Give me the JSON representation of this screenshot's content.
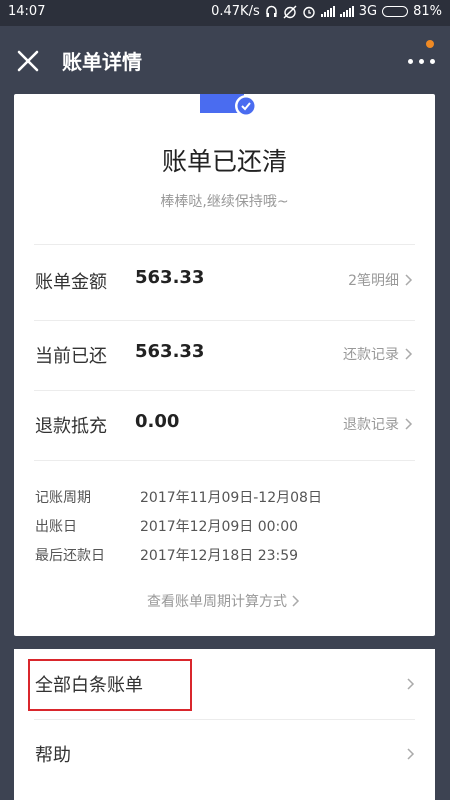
{
  "status_bar": {
    "time": "14:07",
    "network_speed": "0.47K/s",
    "network_type": "3G",
    "battery": "81%",
    "battery_level": 0.81,
    "icons": [
      "headphones-icon",
      "alarm-off-icon",
      "alarm-icon",
      "signal-icon",
      "signal-icon",
      "battery-icon"
    ]
  },
  "header": {
    "title": "账单详情",
    "close_icon": "close-icon",
    "more_icon": "more-icon",
    "notify_color": "#f08a24"
  },
  "bill_status": {
    "title": "账单已还清",
    "subtitle": "棒棒哒,继续保持哦~",
    "icon": "bill-check-icon",
    "icon_color": "#4a6cf0"
  },
  "rows": [
    {
      "label": "账单金额",
      "amount": "563.33",
      "link": "2笔明细"
    },
    {
      "label": "当前已还",
      "amount": "563.33",
      "link": "还款记录"
    },
    {
      "label": "退款抵充",
      "amount": "0.00",
      "link": "退款记录"
    }
  ],
  "info": [
    {
      "label": "记账周期",
      "value": "2017年11月09日-12月08日"
    },
    {
      "label": "出账日",
      "value": "2017年12月09日 00:00"
    },
    {
      "label": "最后还款日",
      "value": "2017年12月18日 23:59"
    }
  ],
  "calc_link": "查看账单周期计算方式",
  "menu": [
    {
      "label": "全部白条账单"
    },
    {
      "label": "帮助"
    }
  ],
  "highlight_color": "#d9262c"
}
